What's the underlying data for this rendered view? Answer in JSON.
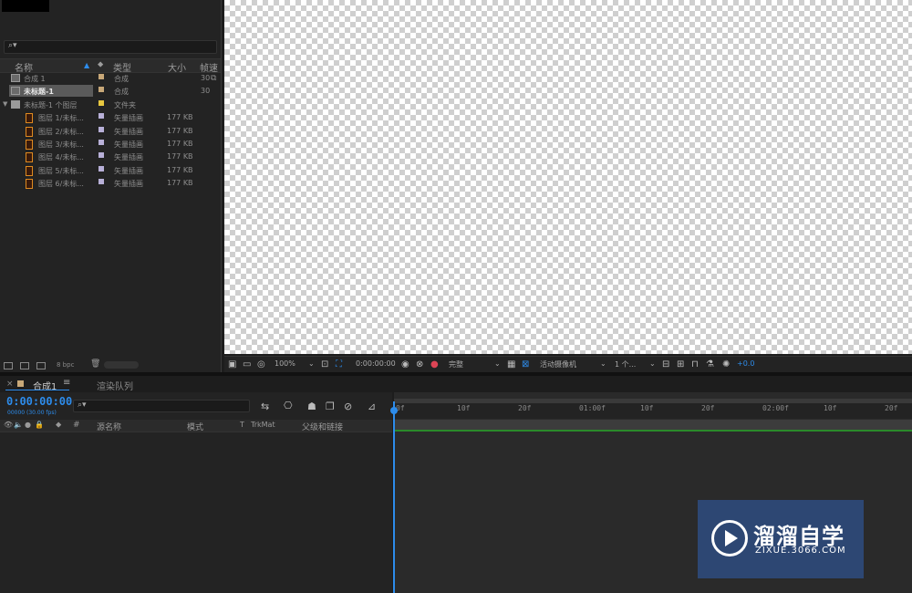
{
  "project": {
    "header": {
      "name": "名称",
      "type": "类型",
      "size": "大小",
      "fps": "帧速"
    },
    "items": [
      {
        "name": "合成 1",
        "type": "合成",
        "size": "",
        "fps": "30",
        "label_color": "#c8a878",
        "kind": "comp",
        "indent": 0
      },
      {
        "name": "未标题-1",
        "type": "合成",
        "size": "",
        "fps": "30",
        "label_color": "#c8a878",
        "kind": "comp",
        "indent": 0,
        "selected": true
      },
      {
        "name": "未标题-1 个图层",
        "type": "文件夹",
        "size": "",
        "fps": "",
        "label_color": "#e8c840",
        "kind": "folder",
        "indent": 0
      },
      {
        "name": "图层 1/未标...",
        "type": "矢量插画",
        "size": "177 KB",
        "fps": "",
        "label_color": "#b8b0d8",
        "kind": "ai",
        "indent": 1
      },
      {
        "name": "图层 2/未标...",
        "type": "矢量插画",
        "size": "177 KB",
        "fps": "",
        "label_color": "#b8b0d8",
        "kind": "ai",
        "indent": 1
      },
      {
        "name": "图层 3/未标...",
        "type": "矢量插画",
        "size": "177 KB",
        "fps": "",
        "label_color": "#b8b0d8",
        "kind": "ai",
        "indent": 1
      },
      {
        "name": "图层 4/未标...",
        "type": "矢量插画",
        "size": "177 KB",
        "fps": "",
        "label_color": "#b8b0d8",
        "kind": "ai",
        "indent": 1
      },
      {
        "name": "图层 5/未标...",
        "type": "矢量插画",
        "size": "177 KB",
        "fps": "",
        "label_color": "#b8b0d8",
        "kind": "ai",
        "indent": 1
      },
      {
        "name": "图层 6/未标...",
        "type": "矢量插画",
        "size": "177 KB",
        "fps": "",
        "label_color": "#b8b0d8",
        "kind": "ai",
        "indent": 1
      }
    ],
    "footer": {
      "bpc": "8 bpc"
    }
  },
  "viewer": {
    "zoom": "100%",
    "timecode": "0:00:00:00",
    "resolution": "完整",
    "camera": "活动摄像机",
    "views": "1 个...",
    "exposure": "+0.0"
  },
  "timeline": {
    "tab_comp": "合成1",
    "tab_render": "渲染队列",
    "time": "0:00:00:00",
    "fps_label": "00000 (30.00 fps)",
    "columns": {
      "source": "源名称",
      "mode": "模式",
      "t": "T",
      "trkmat": "TrkMat",
      "parent": "父级和链接",
      "num": "#"
    },
    "ruler_ticks": [
      "0f",
      "10f",
      "20f",
      "01:00f",
      "10f",
      "20f",
      "02:00f",
      "10f",
      "20f"
    ]
  },
  "watermark": {
    "title": "溜溜自学",
    "subtitle": "ZIXUE.3066.COM"
  },
  "colors": {
    "accent": "#2d8ceb",
    "panel": "#232323",
    "work_area": "#3c3c3c"
  }
}
